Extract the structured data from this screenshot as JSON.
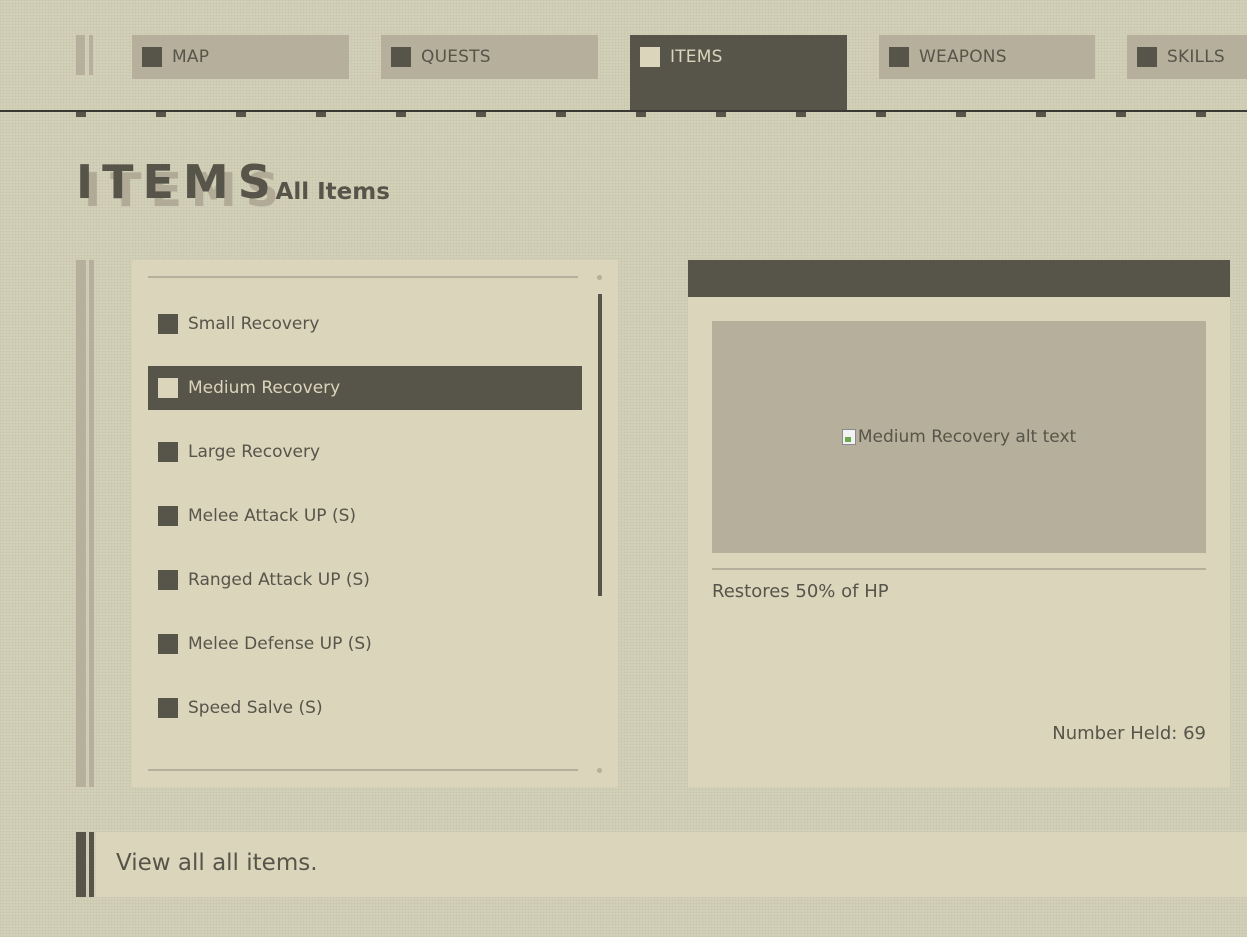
{
  "nav": {
    "tabs": [
      {
        "label": "MAP",
        "active": false
      },
      {
        "label": "QUESTS",
        "active": false
      },
      {
        "label": "ITEMS",
        "active": true
      },
      {
        "label": "WEAPONS",
        "active": false
      },
      {
        "label": "SKILLS",
        "active": false
      }
    ]
  },
  "header": {
    "title": "ITEMS",
    "subtitle": "- All Items"
  },
  "items": {
    "list": [
      {
        "label": "Small Recovery",
        "selected": false
      },
      {
        "label": "Medium Recovery",
        "selected": true
      },
      {
        "label": "Large Recovery",
        "selected": false
      },
      {
        "label": "Melee Attack UP (S)",
        "selected": false
      },
      {
        "label": "Ranged Attack UP (S)",
        "selected": false
      },
      {
        "label": "Melee Defense UP (S)",
        "selected": false
      },
      {
        "label": "Speed Salve (S)",
        "selected": false
      }
    ]
  },
  "detail": {
    "image_alt": "Medium Recovery alt text",
    "description": "Restores 50% of HP",
    "number_held": "Number Held: 69"
  },
  "footer": {
    "text": "View all all items."
  },
  "colors": {
    "background": "#d3d0b8",
    "panel": "#dad5bb",
    "accent_dark": "#57544a",
    "muted": "#b5af9b"
  }
}
